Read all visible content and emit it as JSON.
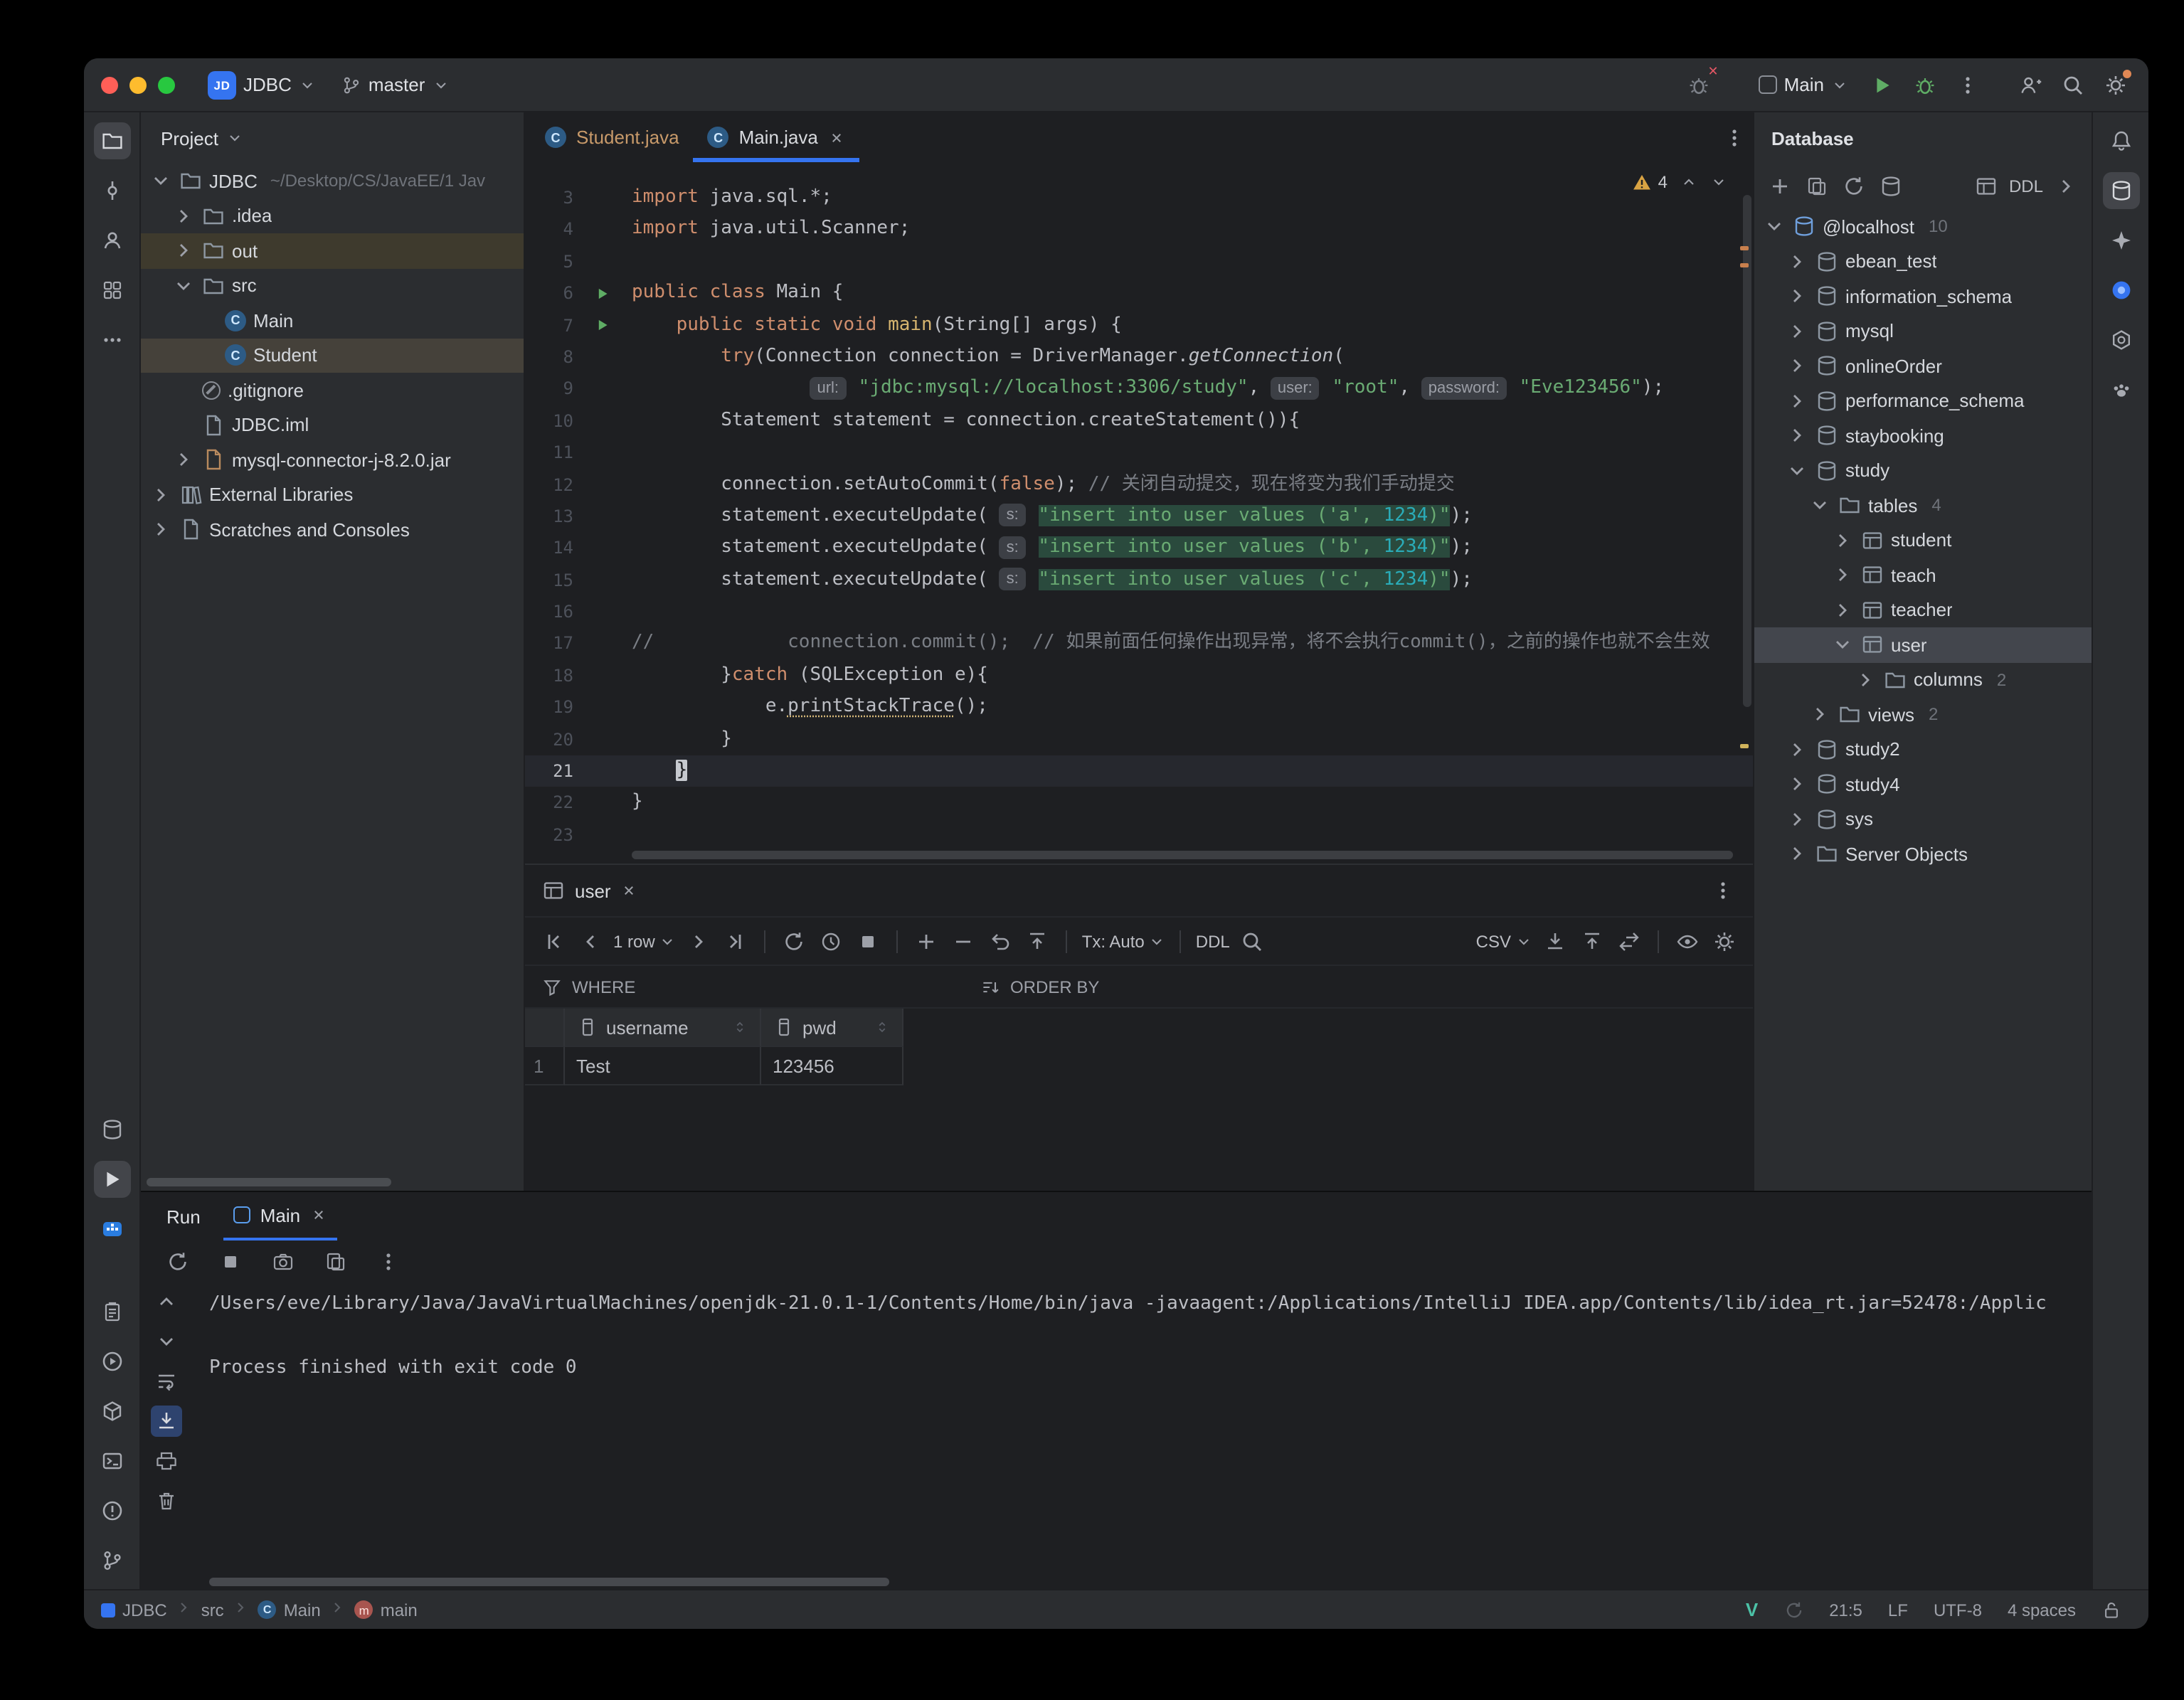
{
  "titlebar": {
    "project": "JDBC",
    "branch": "master",
    "run_config": "Main"
  },
  "icons": {
    "project-logo-icon": "blue JD square",
    "git-branch-icon": "branch",
    "run-button": "green play",
    "debug-button": "green bug",
    "search-everywhere-button": "magnifier",
    "settings-button": "gear with orange badge",
    "code-with-me-button": "user-plus",
    "notifications-button": "bell",
    "database-tool-icon": "db cylinder",
    "warning-icon": "yellow triangle",
    "where-filter-icon": "funnel",
    "order-by-icon": "sort lines",
    "scroll-to-end-button": "arrow down to line",
    "clear-console-button": "trash"
  },
  "tool_strips": {
    "left_top": [
      {
        "name": "project-toolwindow-button",
        "icon": "folder",
        "active": true
      },
      {
        "name": "commit-toolwindow-button",
        "icon": "commit"
      },
      {
        "name": "pull-requests-toolwindow-button",
        "icon": "person"
      },
      {
        "name": "structure-toolwindow-button",
        "icon": "structure"
      },
      {
        "name": "more-toolwindows-button",
        "icon": "kebab-h"
      }
    ],
    "left_mid": [
      {
        "name": "services-toolwindow-button",
        "icon": "db"
      },
      {
        "name": "run-toolwindow-button",
        "icon": "play",
        "active": true
      },
      {
        "name": "docker-toolwindow-button",
        "icon": "docker"
      }
    ],
    "left_bottom": [
      {
        "name": "todo-toolwindow-button",
        "icon": "clipboard"
      },
      {
        "name": "profiler-toolwindow-button",
        "icon": "circleplay"
      },
      {
        "name": "build-toolwindow-button",
        "icon": "box"
      },
      {
        "name": "terminal-toolwindow-button",
        "icon": "terminal"
      },
      {
        "name": "problems-toolwindow-button",
        "icon": "problems"
      },
      {
        "name": "git-toolwindow-button",
        "icon": "branch"
      }
    ],
    "right_top": [
      {
        "name": "notifications-button",
        "icon": "bell"
      },
      {
        "name": "database-toolwindow-button",
        "icon": "db",
        "active": true
      },
      {
        "name": "ai-assistant-toolwindow-button",
        "icon": "sparkle"
      },
      {
        "name": "plugin-blue-button",
        "icon": "circle"
      },
      {
        "name": "openai-plugin-button",
        "icon": "hex"
      },
      {
        "name": "paw-plugin-button",
        "icon": "paw"
      }
    ]
  },
  "project_panel": {
    "title": "Project",
    "items": [
      {
        "label": "JDBC",
        "hint": "~/Desktop/CS/JavaEE/1 Jav",
        "depth": 0,
        "icon": "folder",
        "chev": "down"
      },
      {
        "label": ".idea",
        "depth": 1,
        "icon": "folder",
        "chev": "right"
      },
      {
        "label": "out",
        "depth": 1,
        "icon": "folder",
        "chev": "right",
        "cls": "excluded"
      },
      {
        "label": "src",
        "depth": 1,
        "icon": "folder",
        "chev": "down"
      },
      {
        "label": "Main",
        "depth": 2,
        "icon": "class"
      },
      {
        "label": "Student",
        "depth": 2,
        "icon": "class",
        "cls": "active-file"
      },
      {
        "label": ".gitignore",
        "depth": 1,
        "icon": "ignored"
      },
      {
        "label": "JDBC.iml",
        "depth": 1,
        "icon": "file"
      },
      {
        "label": "mysql-connector-j-8.2.0.jar",
        "depth": 1,
        "icon": "jar",
        "chev": "right"
      },
      {
        "label": "External Libraries",
        "depth": 0,
        "icon": "lib",
        "chev": "right"
      },
      {
        "label": "Scratches and Consoles",
        "depth": 0,
        "icon": "scratch",
        "chev": "right"
      }
    ]
  },
  "editor_tabs": [
    {
      "label": "Student.java",
      "cls": "warm"
    },
    {
      "label": "Main.java",
      "active": true
    }
  ],
  "editor": {
    "warning_count": "4",
    "lines": [
      {
        "n": "3",
        "t": [
          [
            "k",
            "import"
          ],
          [
            "p",
            " java.sql.*;"
          ]
        ]
      },
      {
        "n": "4",
        "t": [
          [
            "k",
            "import"
          ],
          [
            "p",
            " java.util.Scanner;"
          ]
        ]
      },
      {
        "n": "5",
        "t": []
      },
      {
        "n": "6",
        "g": "run",
        "t": [
          [
            "k",
            "public"
          ],
          [
            "p",
            " "
          ],
          [
            "k",
            "class"
          ],
          [
            "p",
            " Main {"
          ]
        ]
      },
      {
        "n": "7",
        "g": "run",
        "t": [
          [
            "p",
            "    "
          ],
          [
            "k",
            "public"
          ],
          [
            "p",
            " "
          ],
          [
            "k",
            "static"
          ],
          [
            "p",
            " "
          ],
          [
            "k",
            "void"
          ],
          [
            "p",
            " "
          ],
          [
            "m",
            "main"
          ],
          [
            "p",
            "(String[] args) {"
          ]
        ]
      },
      {
        "n": "8",
        "t": [
          [
            "p",
            "        "
          ],
          [
            "k",
            "try"
          ],
          [
            "p",
            "(Connection connection = DriverManager."
          ],
          [
            "mi",
            "getConnection"
          ],
          [
            "p",
            "("
          ]
        ]
      },
      {
        "n": "9",
        "t": [
          [
            "p",
            "                "
          ],
          [
            "inlay",
            "url:"
          ],
          [
            "s",
            " \"jdbc:mysql://localhost:3306/study\""
          ],
          [
            "p",
            ", "
          ],
          [
            "inlay",
            "user:"
          ],
          [
            "s",
            " \"root\""
          ],
          [
            "p",
            ", "
          ],
          [
            "inlay",
            "password:"
          ],
          [
            "s",
            " \"Eve123456\""
          ],
          [
            "p",
            ");"
          ]
        ]
      },
      {
        "n": "10",
        "t": [
          [
            "p",
            "        Statement statement = connection.createStatement()){"
          ]
        ]
      },
      {
        "n": "11",
        "t": []
      },
      {
        "n": "12",
        "t": [
          [
            "p",
            "        connection.setAutoCommit("
          ],
          [
            "k",
            "false"
          ],
          [
            "p",
            "); "
          ],
          [
            "c",
            "// 关闭自动提交，现在将变为我们手动提交"
          ]
        ]
      },
      {
        "n": "13",
        "t": [
          [
            "p",
            "        statement.executeUpdate( "
          ],
          [
            "inlay",
            "s:"
          ],
          [
            "p",
            " "
          ],
          [
            "hs",
            "\"insert into user values ('a', "
          ],
          [
            "hn",
            "1234"
          ],
          [
            "hs",
            ")\""
          ],
          [
            "p",
            ");"
          ]
        ]
      },
      {
        "n": "14",
        "t": [
          [
            "p",
            "        statement.executeUpdate( "
          ],
          [
            "inlay",
            "s:"
          ],
          [
            "p",
            " "
          ],
          [
            "hs",
            "\"insert into user values ('b', "
          ],
          [
            "hn",
            "1234"
          ],
          [
            "hs",
            ")\""
          ],
          [
            "p",
            ");"
          ]
        ]
      },
      {
        "n": "15",
        "t": [
          [
            "p",
            "        statement.executeUpdate( "
          ],
          [
            "inlay",
            "s:"
          ],
          [
            "p",
            " "
          ],
          [
            "hs",
            "\"insert into user values ('c', "
          ],
          [
            "hn",
            "1234"
          ],
          [
            "hs",
            ")\""
          ],
          [
            "p",
            ");"
          ]
        ]
      },
      {
        "n": "16",
        "t": []
      },
      {
        "n": "17",
        "t": [
          [
            "c",
            "//            connection.commit();  // 如果前面任何操作出现异常，将不会执行commit()，之前的操作也就不会生效"
          ]
        ]
      },
      {
        "n": "18",
        "t": [
          [
            "p",
            "        }"
          ],
          [
            "k",
            "catch"
          ],
          [
            "p",
            " (SQLException e){"
          ]
        ]
      },
      {
        "n": "19",
        "t": [
          [
            "p",
            "            e."
          ],
          [
            "w",
            "printStackTrace"
          ],
          [
            "p",
            "();"
          ]
        ]
      },
      {
        "n": "20",
        "t": [
          [
            "p",
            "        }"
          ]
        ]
      },
      {
        "n": "21",
        "cur": true,
        "t": [
          [
            "p",
            "    "
          ],
          [
            "caret",
            "}"
          ]
        ]
      },
      {
        "n": "22",
        "t": [
          [
            "p",
            "}"
          ]
        ]
      },
      {
        "n": "23",
        "t": []
      }
    ]
  },
  "table_panel": {
    "tab": "user",
    "toolbar": {
      "rows": "1 row",
      "tx": "Tx: Auto",
      "ddl": "DDL",
      "csv": "CSV"
    },
    "filter": {
      "where": "WHERE",
      "order_by": "ORDER BY"
    },
    "grid": {
      "columns": [
        "username",
        "pwd"
      ],
      "rows": [
        {
          "num": "1",
          "cells": [
            "Test",
            "123456"
          ]
        }
      ]
    }
  },
  "run_panel": {
    "label": "Run",
    "tab": "Main",
    "console": [
      "/Users/eve/Library/Java/JavaVirtualMachines/openjdk-21.0.1-1/Contents/Home/bin/java -javaagent:/Applications/IntelliJ IDEA.app/Contents/lib/idea_rt.jar=52478:/Applic",
      "",
      "Process finished with exit code 0"
    ]
  },
  "database_panel": {
    "title": "Database",
    "ddl": "DDL",
    "tree": [
      {
        "label": "@localhost",
        "count": "10",
        "depth": 0,
        "icon": "datasource",
        "chev": "down"
      },
      {
        "label": "ebean_test",
        "depth": 1,
        "icon": "schema",
        "chev": "right"
      },
      {
        "label": "information_schema",
        "depth": 1,
        "icon": "schema",
        "chev": "right"
      },
      {
        "label": "mysql",
        "depth": 1,
        "icon": "schema",
        "chev": "right"
      },
      {
        "label": "onlineOrder",
        "depth": 1,
        "icon": "schema",
        "chev": "right"
      },
      {
        "label": "performance_schema",
        "depth": 1,
        "icon": "schema",
        "chev": "right"
      },
      {
        "label": "staybooking",
        "depth": 1,
        "icon": "schema",
        "chev": "right"
      },
      {
        "label": "study",
        "depth": 1,
        "icon": "schema",
        "chev": "down"
      },
      {
        "label": "tables",
        "count": "4",
        "depth": 2,
        "icon": "folder",
        "chev": "down"
      },
      {
        "label": "student",
        "depth": 3,
        "icon": "table",
        "chev": "right"
      },
      {
        "label": "teach",
        "depth": 3,
        "icon": "table",
        "chev": "right"
      },
      {
        "label": "teacher",
        "depth": 3,
        "icon": "table",
        "chev": "right"
      },
      {
        "label": "user",
        "depth": 3,
        "icon": "table",
        "chev": "down",
        "selected": true
      },
      {
        "label": "columns",
        "count": "2",
        "depth": 4,
        "icon": "folder",
        "chev": "right"
      },
      {
        "label": "views",
        "count": "2",
        "depth": 2,
        "icon": "folder",
        "chev": "right"
      },
      {
        "label": "study2",
        "depth": 1,
        "icon": "schema",
        "chev": "right"
      },
      {
        "label": "study4",
        "depth": 1,
        "icon": "schema",
        "chev": "right"
      },
      {
        "label": "sys",
        "depth": 1,
        "icon": "schema",
        "chev": "right"
      },
      {
        "label": "Server Objects",
        "depth": 1,
        "icon": "folder",
        "chev": "right"
      }
    ]
  },
  "statusbar": {
    "crumbs": [
      {
        "label": "JDBC",
        "icon": "project"
      },
      {
        "label": "src"
      },
      {
        "label": "Main",
        "icon": "class"
      },
      {
        "label": "main",
        "icon": "method"
      }
    ],
    "vim": "V",
    "caret": "21:5",
    "line_ending": "LF",
    "encoding": "UTF-8",
    "indent": "4 spaces"
  }
}
